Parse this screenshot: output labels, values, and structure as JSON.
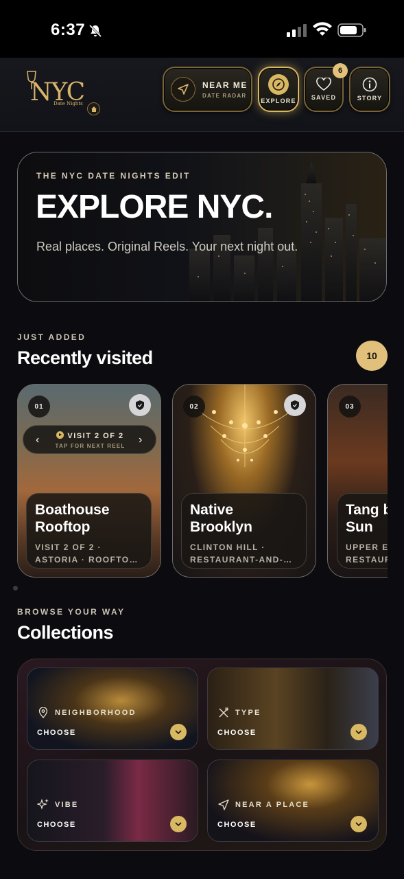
{
  "status_bar": {
    "time": "6:37"
  },
  "header": {
    "logo_text": "NYC",
    "logo_sub": "Date Nights",
    "near_me": {
      "title": "NEAR ME",
      "subtitle": "DATE RADAR"
    },
    "explore_label": "EXPLORE",
    "saved_label": "SAVED",
    "saved_badge": "6",
    "story_label": "STORY",
    "accent": "#d9b864"
  },
  "hero": {
    "kicker": "THE NYC DATE NIGHTS EDIT",
    "title": "EXPLORE NYC.",
    "subtitle": "Real places. Original Reels. Your next night out."
  },
  "recent": {
    "kicker": "JUST ADDED",
    "title": "Recently visited",
    "count": "10",
    "cards": [
      {
        "num": "01",
        "title_line1": "Boathouse",
        "title_line2": "Rooftop",
        "meta_line1": "VISIT 2 OF 2 ·",
        "meta_line2": "ASTORIA · ROOFTO…",
        "visit_pill": "VISIT 2 OF 2",
        "visit_hint": "TAP FOR NEXT REEL"
      },
      {
        "num": "02",
        "title_line1": "Native",
        "title_line2": "Brooklyn",
        "meta_line1": "CLINTON HILL ·",
        "meta_line2": "RESTAURANT-AND-…"
      },
      {
        "num": "03",
        "title_line1": "Tang b",
        "title_line2": "Sun",
        "meta_line1": "UPPER E",
        "meta_line2": "RESTAUR"
      }
    ]
  },
  "collections": {
    "kicker": "BROWSE YOUR WAY",
    "title": "Collections",
    "tiles": [
      {
        "label": "NEIGHBORHOOD",
        "action": "CHOOSE",
        "icon": "pin-icon"
      },
      {
        "label": "TYPE",
        "action": "CHOOSE",
        "icon": "utensils-icon"
      },
      {
        "label": "VIBE",
        "action": "CHOOSE",
        "icon": "sparkles-icon"
      },
      {
        "label": "NEAR A PLACE",
        "action": "CHOOSE",
        "icon": "navigation-icon"
      }
    ]
  }
}
